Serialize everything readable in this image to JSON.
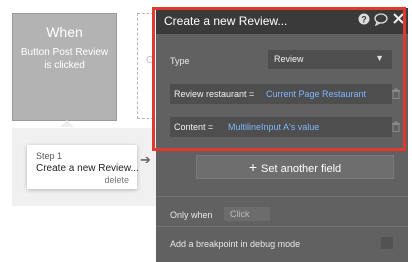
{
  "workflow": {
    "when_title": "When",
    "when_subtitle": "Button Post Review is clicked",
    "dashed_char": "C",
    "step_number": "Step 1",
    "step_name": "Create a new Review...",
    "step_delete": "delete",
    "arrow_glyph": "➔"
  },
  "panel": {
    "title": "Create a new Review...",
    "icons": [
      "help-icon",
      "comment-icon",
      "close-icon"
    ],
    "type_label": "Type",
    "type_value": "Review",
    "fields": [
      {
        "label": "Review restaurant  =",
        "value": "Current Page Restaurant"
      },
      {
        "label": "Content  =",
        "value": "MultilineInput A's value"
      }
    ],
    "set_another": "Set another field",
    "only_when_label": "Only when",
    "only_when_value": "Click",
    "breakpoint_label": "Add a breakpoint in debug mode",
    "highlight_color": "#e03a2f",
    "link_color": "#7fb6ff"
  }
}
